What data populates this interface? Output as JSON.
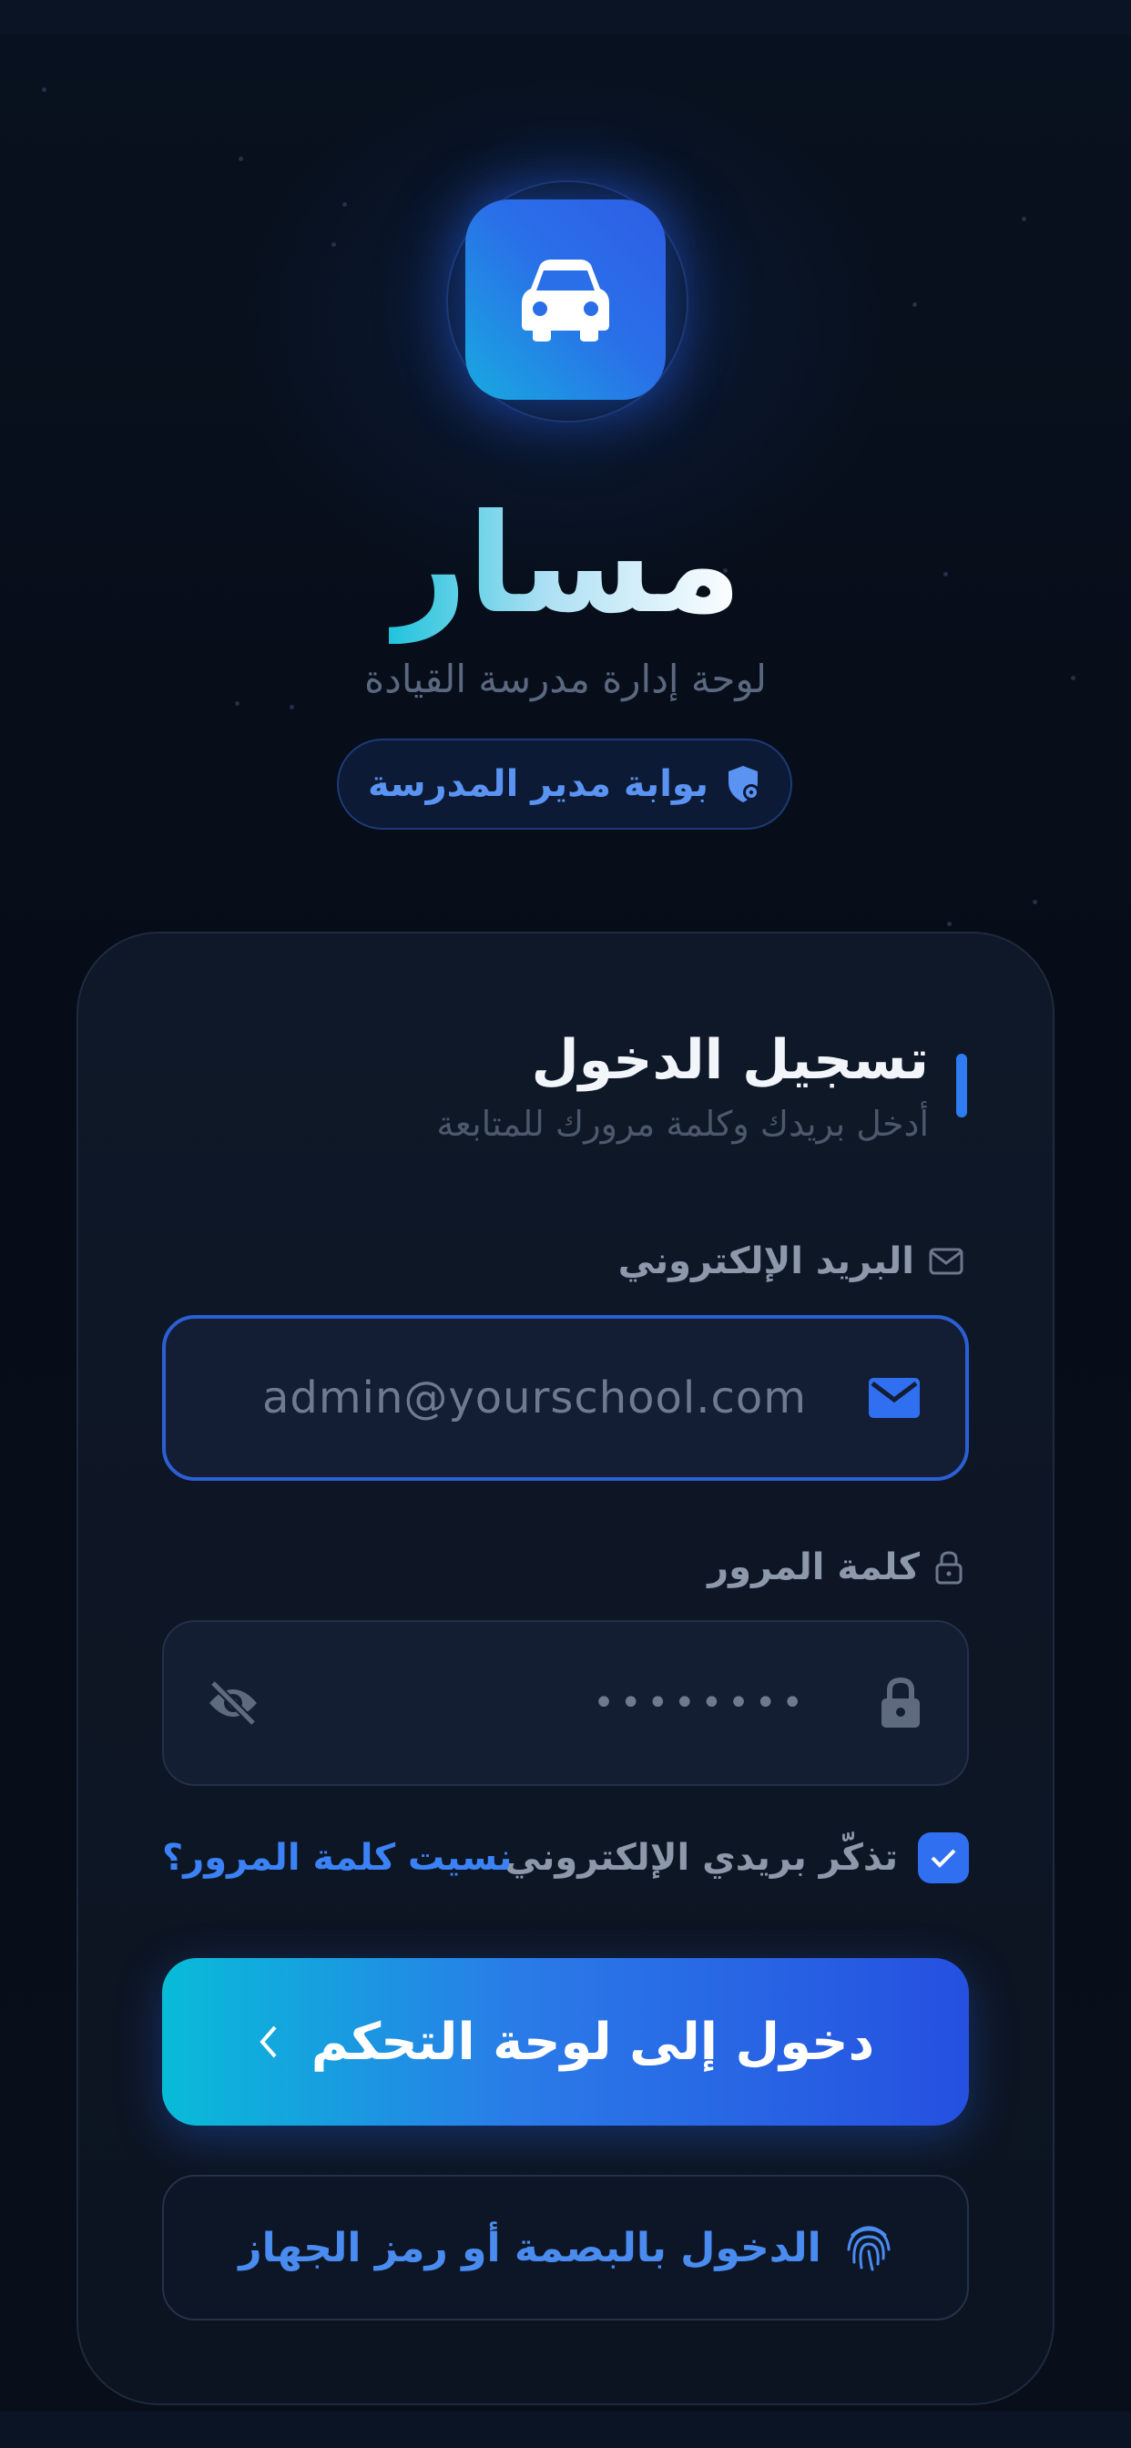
{
  "app": {
    "name": "مسار",
    "tagline": "لوحة إدارة مدرسة القيادة",
    "portal_badge": "بوابة مدير المدرسة",
    "logo_icon": "car-icon"
  },
  "login": {
    "title": "تسجيل الدخول",
    "subtitle": "أدخل بريدك وكلمة مرورك للمتابعة",
    "email": {
      "label": "البريد الإلكتروني",
      "placeholder": "admin@yourschool.com",
      "icon": "mail-icon"
    },
    "password": {
      "label": "كلمة المرور",
      "masked_value": "••••••••",
      "icon": "lock-icon",
      "toggle_icon": "eye-off-icon"
    },
    "remember_label": "تذكّر بريدي الإلكتروني",
    "remember_checked": true,
    "forgot_label": "نسيت كلمة المرور؟",
    "submit_label": "دخول إلى لوحة التحكم",
    "biometric_label": "الدخول بالبصمة أو رمز الجهاز"
  },
  "colors": {
    "background": "#070d18",
    "accent": "#2f6ff0",
    "accent_cyan": "#08bcd8",
    "link": "#3b82f6",
    "card": "#0f1828"
  }
}
